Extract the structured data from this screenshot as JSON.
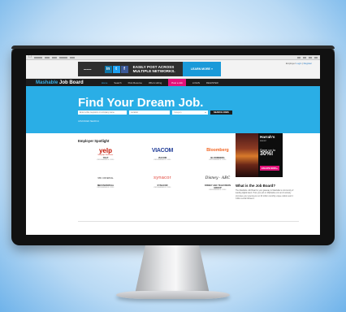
{
  "topbar": {
    "ad": {
      "social": [
        "in",
        "t",
        "f"
      ],
      "headline": "EASILY POST ACROSS MULTIPLE NETWORKS.",
      "cta": "LEARN MORE »"
    },
    "util": {
      "prefix": "Employer",
      "login": "Login",
      "sep": " | ",
      "register": "Register"
    }
  },
  "nav": {
    "brand_part1": "Mashable",
    "brand_part2": " Job Board",
    "items": [
      "Home",
      "Search",
      "Post Resume",
      "Who's Hiring"
    ],
    "cta": "Post a Job",
    "login": "LOGIN",
    "register": "REGISTER"
  },
  "hero": {
    "title": "Find Your Dream Job.",
    "keywords_placeholder": "Enter a title, keyword, or company name",
    "location_placeholder": "Location",
    "category_placeholder": "Category",
    "search_button": "SEARCH JOBS",
    "advanced": "ADVANCED SEARCH"
  },
  "spotlight": {
    "title": "Employer Spotlight",
    "employers": [
      {
        "logo": "yelp",
        "logo_sub": "Real people. Real reviews.",
        "name": "YELP",
        "jobs": "VIEW AVAILABLE JOBS ›"
      },
      {
        "logo": "VIACOM",
        "name": "VIACOM",
        "jobs": "VIEW AVAILABLE JOBS ›"
      },
      {
        "logo": "Bloomberg",
        "name": "BLOOMBERG",
        "jobs": "VIEW AVAILABLE JOBS ›"
      },
      {
        "logo": "NBC UNIVERSAL",
        "name": "NBCUNIVERSAL",
        "jobs": "VIEW AVAILABLE JOBS ›"
      },
      {
        "logo": "synacor",
        "name": "SYNACOR",
        "jobs": "VIEW AVAILABLE JOBS ›"
      },
      {
        "logo": "Disney · ABC",
        "name": "DISNEY ABC TELEVISION GROUP",
        "jobs": "VIEW AVAILABLE JOBS ›"
      }
    ]
  },
  "side_ad": {
    "brand": "Harrah's",
    "brand_sub": "RESORT",
    "line1": "Save up to",
    "percent": "30%!",
    "cta": "ESCAPE NOW ▸"
  },
  "about": {
    "title": "What is the Job Board?",
    "body": "The Mashable Job Board is your gateway to Mashable's community of leading digital talent. Post your job on Mashable.com and it actively promotes your opening to our 20 million monthly unique visitors and 4 million social followers."
  },
  "colors": {
    "accent": "#2aaee6",
    "nav": "#1c1c1c",
    "cta": "#e3127a"
  }
}
